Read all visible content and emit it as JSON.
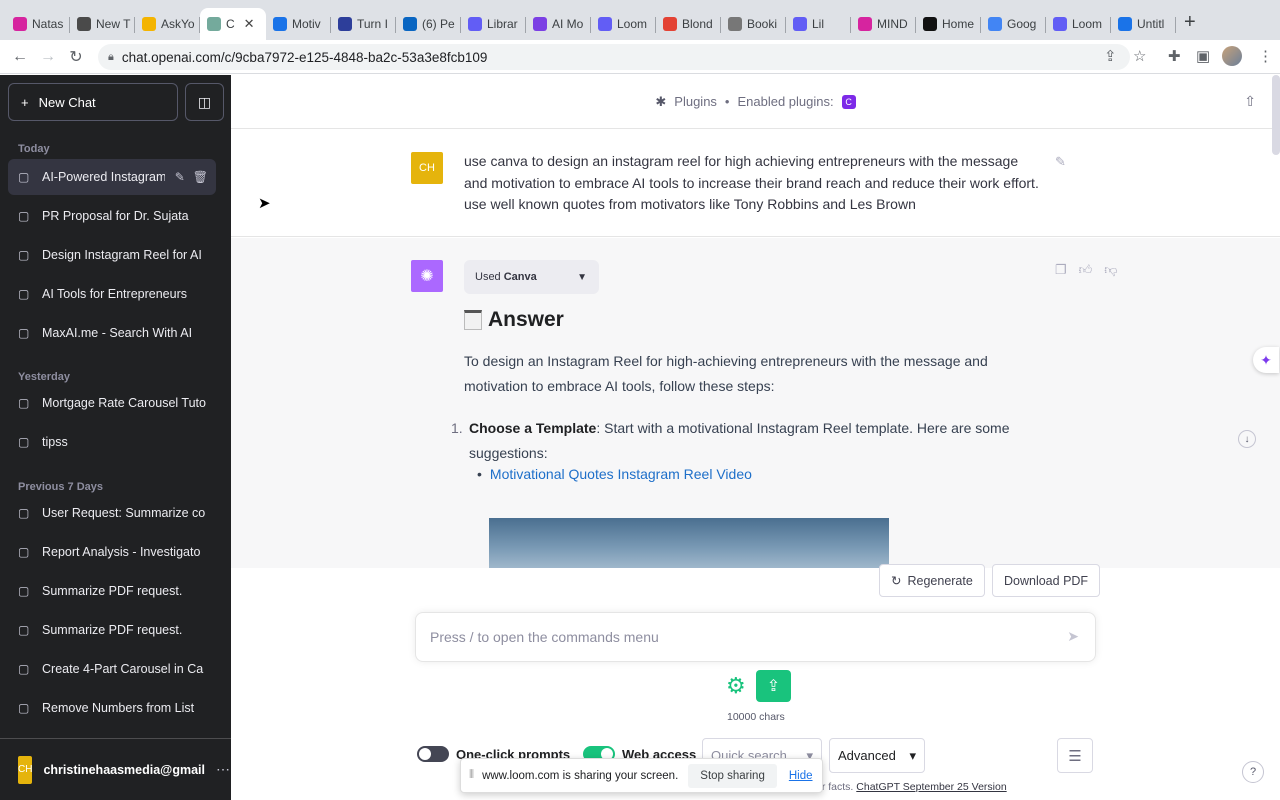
{
  "browser": {
    "tabs": [
      {
        "label": "Natas",
        "color": "#d6249f"
      },
      {
        "label": "New T",
        "color": "#4a4a4a"
      },
      {
        "label": "AskYo",
        "color": "#f4b400"
      },
      {
        "label": "C",
        "color": "#74aa9c",
        "active": true
      },
      {
        "label": "Motiv",
        "color": "#1a73e8"
      },
      {
        "label": "Turn I",
        "color": "#2d3e9a"
      },
      {
        "label": "(6) Pe",
        "color": "#0a66c2"
      },
      {
        "label": "Librar",
        "color": "#625df5"
      },
      {
        "label": "AI Mo",
        "color": "#7b3fe4"
      },
      {
        "label": "Loom",
        "color": "#625df5"
      },
      {
        "label": "Blond",
        "color": "#e34234"
      },
      {
        "label": "Booki",
        "color": "#777777"
      },
      {
        "label": "Lil",
        "color": "#625df5"
      },
      {
        "label": "MIND",
        "color": "#d6249f"
      },
      {
        "label": "Home",
        "color": "#111111"
      },
      {
        "label": "Goog",
        "color": "#4285f4"
      },
      {
        "label": "Loom",
        "color": "#625df5"
      },
      {
        "label": "Untitl",
        "color": "#1a73e8"
      }
    ],
    "url": "chat.openai.com/c/9cba7972-e125-4848-ba2c-53a3e8fcb109"
  },
  "sidebar": {
    "new_chat": "New Chat",
    "sections": [
      {
        "title": "Today",
        "items": [
          "AI-Powered Instagram",
          "PR Proposal for Dr. Sujata",
          "Design Instagram Reel for AI",
          "AI Tools for Entrepreneurs",
          "MaxAI.me - Search With AI"
        ]
      },
      {
        "title": "Yesterday",
        "items": [
          "Mortgage Rate Carousel Tuto",
          "tipss"
        ]
      },
      {
        "title": "Previous 7 Days",
        "items": [
          "User Request: Summarize co",
          "Report Analysis - Investigato",
          "Summarize PDF request.",
          "Summarize PDF request.",
          "Create 4-Part Carousel in Ca",
          "Remove Numbers from List"
        ]
      }
    ],
    "user_initials": "CH",
    "user_email": "christinehaasmedia@gmail"
  },
  "header": {
    "plugins_label": "Plugins",
    "enabled_label": "Enabled plugins:"
  },
  "user_message": {
    "initials": "CH",
    "text": "use canva to design an instagram reel for high achieving entrepreneurs with the message and motivation to embrace AI tools to increase their brand reach and reduce their work effort.   use well known quotes from motivators like Tony Robbins and Les Brown"
  },
  "bot_message": {
    "used_prefix": "Used",
    "used_plugin": "Canva",
    "answer_title": "Answer",
    "intro": "To design an Instagram Reel for high-achieving entrepreneurs with the message and motivation to embrace AI tools, follow these steps:",
    "step_number": "1.",
    "step_title": "Choose a Template",
    "step_text": ": Start with a motivational Instagram Reel template. Here are some suggestions:",
    "link_text": "Motivational Quotes Instagram Reel Video"
  },
  "actions": {
    "regenerate": "Regenerate",
    "download_pdf": "Download PDF"
  },
  "composer": {
    "placeholder": "Press / to open the commands menu",
    "char_count": "10000 chars",
    "toggle1_label": "One-click prompts",
    "toggle2_label": "Web access",
    "quick_search": "Quick search",
    "advanced": "Advanced",
    "footer_suffix": "or facts.",
    "footer_link": "ChatGPT September 25 Version"
  },
  "loom": {
    "message": "www.loom.com is sharing your screen.",
    "stop": "Stop sharing",
    "hide": "Hide"
  },
  "colors": {
    "sidebar_bg": "#202123",
    "accent_green": "#19c37d",
    "bot_avatar": "#ab68ff",
    "user_avatar": "#e5b40c"
  }
}
